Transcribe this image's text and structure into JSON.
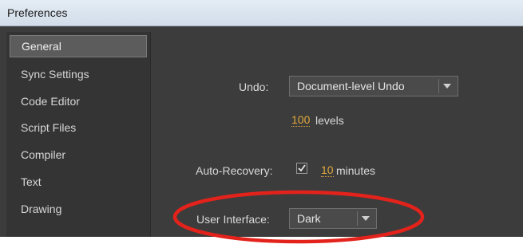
{
  "window": {
    "title": "Preferences"
  },
  "sidebar": {
    "items": [
      {
        "label": "General",
        "selected": true
      },
      {
        "label": "Sync Settings"
      },
      {
        "label": "Code Editor"
      },
      {
        "label": "Script Files"
      },
      {
        "label": "Compiler"
      },
      {
        "label": "Text"
      },
      {
        "label": "Drawing"
      }
    ]
  },
  "general": {
    "undo": {
      "label": "Undo:",
      "value": "Document-level Undo",
      "levels_value": "100",
      "levels_label": "levels"
    },
    "auto_recovery": {
      "label": "Auto-Recovery:",
      "checked": true,
      "minutes_value": "10",
      "minutes_label": "minutes"
    },
    "user_interface": {
      "label": "User Interface:",
      "value": "Dark"
    }
  },
  "colors": {
    "annotation_circle": "#e3231b",
    "value_accent": "#e0a83a"
  }
}
